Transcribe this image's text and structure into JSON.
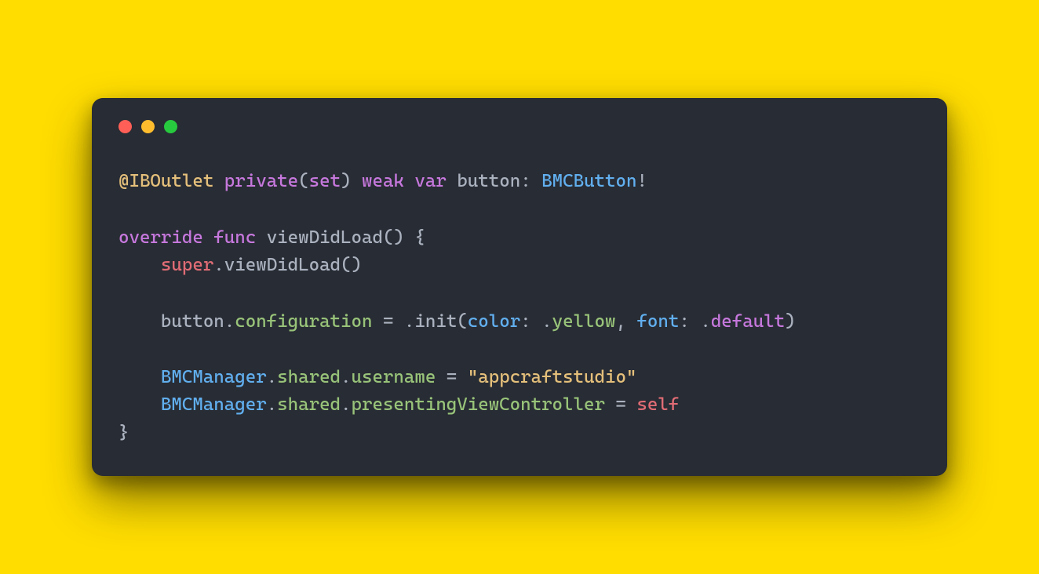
{
  "colors": {
    "page_bg": "#FFDD00",
    "window_bg": "#282C34",
    "traffic_red": "#FF5F56",
    "traffic_amber": "#FFBD2E",
    "traffic_green": "#27C93F"
  },
  "code": {
    "line1": {
      "attr": "@IBOutlet",
      "private": "private",
      "lparen": "(",
      "set": "set",
      "rparen": ")",
      "weak": "weak",
      "var": "var",
      "name": "button",
      "colon": ":",
      "type": "BMCButton",
      "bang": "!"
    },
    "line3": {
      "override": "override",
      "func": "func",
      "name": "viewDidLoad",
      "parens": "()",
      "brace": "{"
    },
    "line4": {
      "super": "super",
      "dot": ".",
      "call": "viewDidLoad",
      "parens": "()"
    },
    "line6": {
      "recv": "button",
      "dot": ".",
      "prop": "configuration",
      "eq": "=",
      "dot2": ".",
      "init": "init",
      "lparen": "(",
      "param1": "color",
      "colon1": ":",
      "dot3": ".",
      "val1": "yellow",
      "comma": ",",
      "param2": "font",
      "colon2": ":",
      "dot4": ".",
      "val2": "default",
      "rparen": ")"
    },
    "line8": {
      "type": "BMCManager",
      "dot": ".",
      "shared": "shared",
      "dot2": ".",
      "prop": "username",
      "eq": "=",
      "string": "\"appcraftstudio\""
    },
    "line9": {
      "type": "BMCManager",
      "dot": ".",
      "shared": "shared",
      "dot2": ".",
      "prop": "presentingViewController",
      "eq": "=",
      "self": "self"
    },
    "line10": {
      "brace": "}"
    }
  }
}
